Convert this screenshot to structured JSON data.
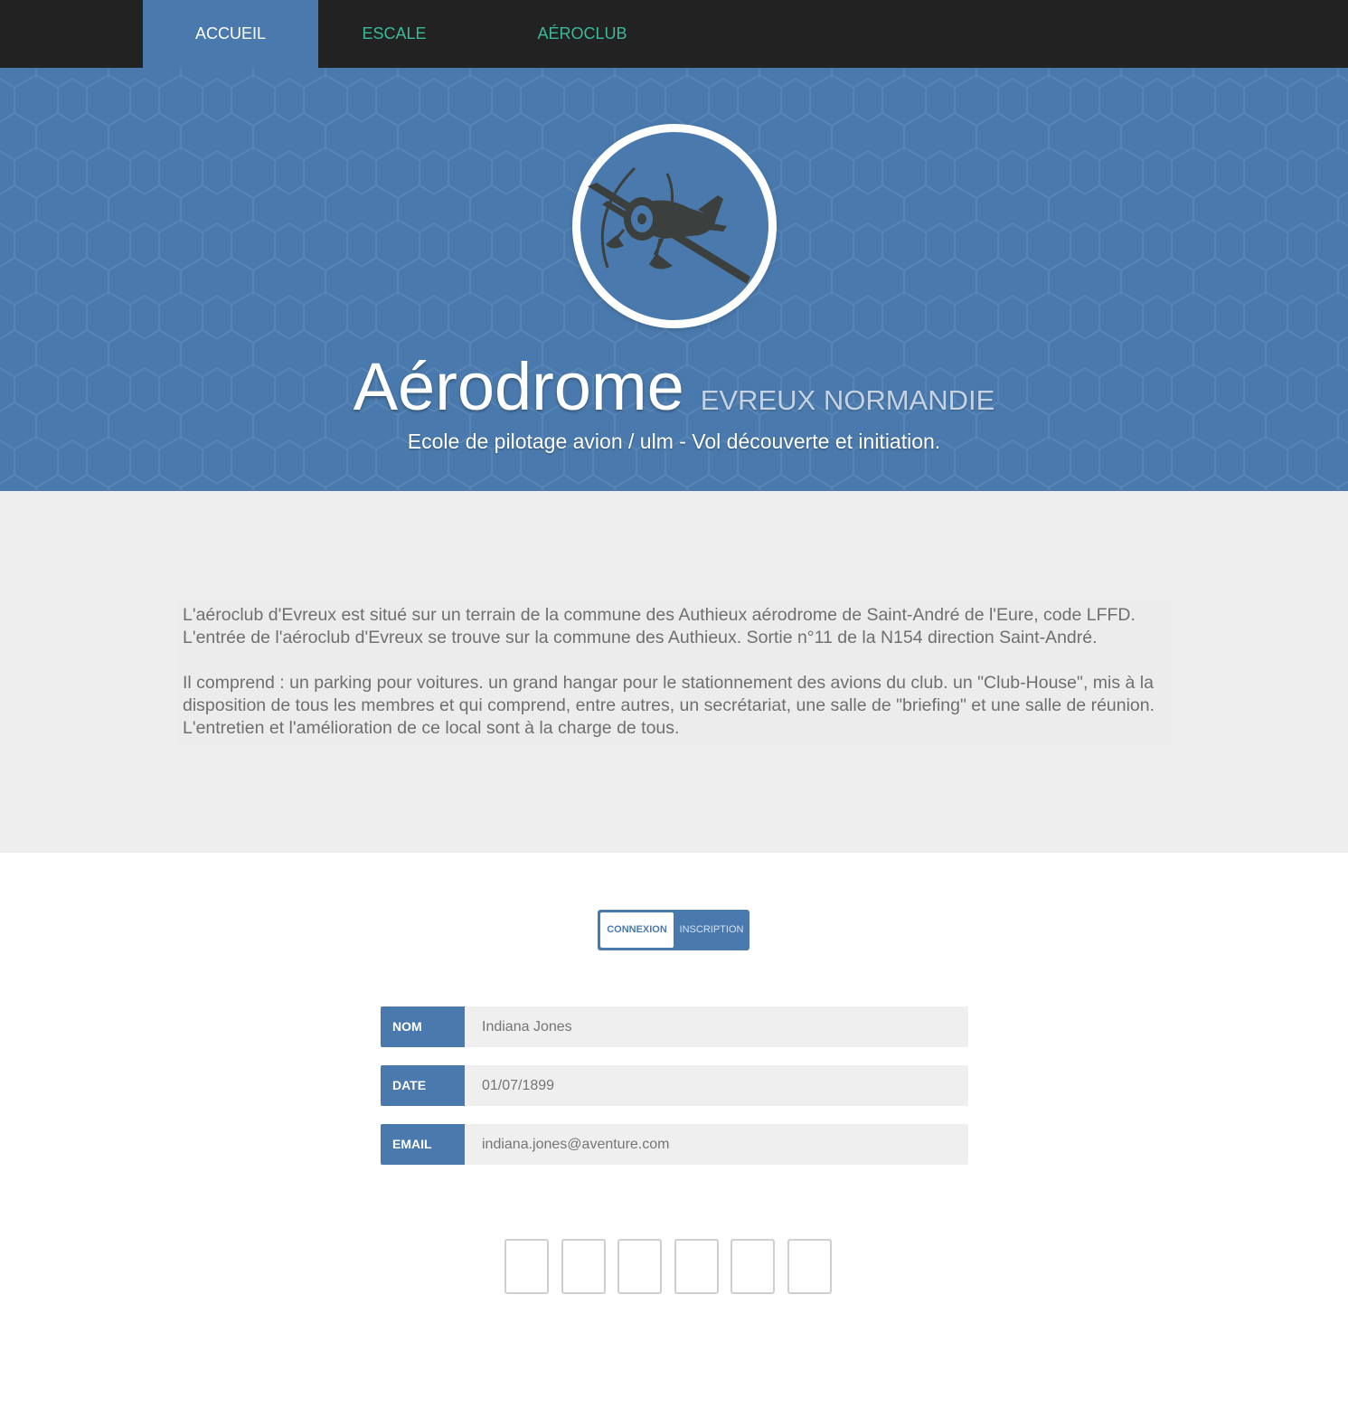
{
  "nav": {
    "items": [
      {
        "label": "ACCUEIL",
        "active": true
      },
      {
        "label": "ESCALE",
        "active": false
      },
      {
        "label": "AÉROCLUB",
        "active": false
      }
    ]
  },
  "hero": {
    "title": "Aérodrome",
    "subtitle": "EVREUX NORMANDIE",
    "tagline": "Ecole de pilotage avion / ulm - Vol découverte et initiation.",
    "emblem_icon": "vintage-airplane-icon"
  },
  "info": {
    "paragraph_1": "L'aéroclub d'Evreux est situé sur un terrain de la commune des Authieux aérodrome de Saint-André de l'Eure, code LFFD. L'entrée de l'aéroclub d'Evreux se trouve sur la commune des Authieux. Sortie n°11 de la N154 direction Saint-André.",
    "paragraph_2": "Il comprend : un parking pour voitures. un grand hangar pour le stationnement des avions du club. un \"Club-House\", mis à la disposition de tous les membres et qui comprend, entre autres, un secrétariat, une salle de \"briefing\" et une salle de réunion. L'entretien et l'amélioration de ce local sont à la charge de tous."
  },
  "toggle": {
    "selected_label": "CONNEXION",
    "other_label": "INSCRIPTION"
  },
  "form": {
    "fields": [
      {
        "label": "NOM",
        "placeholder": "Indiana Jones"
      },
      {
        "label": "DATE",
        "placeholder": "01/07/1899"
      },
      {
        "label": "EMAIL",
        "placeholder": "indiana.jones@aventure.com"
      }
    ]
  },
  "code": {
    "digits": [
      "",
      "",
      "",
      "",
      "",
      ""
    ]
  },
  "colors": {
    "primary": "#4a7aad",
    "nav_background": "#222222",
    "nav_link": "#3cb89a",
    "section_background": "#eeeeee",
    "emblem_art": "#3b3f3d"
  }
}
